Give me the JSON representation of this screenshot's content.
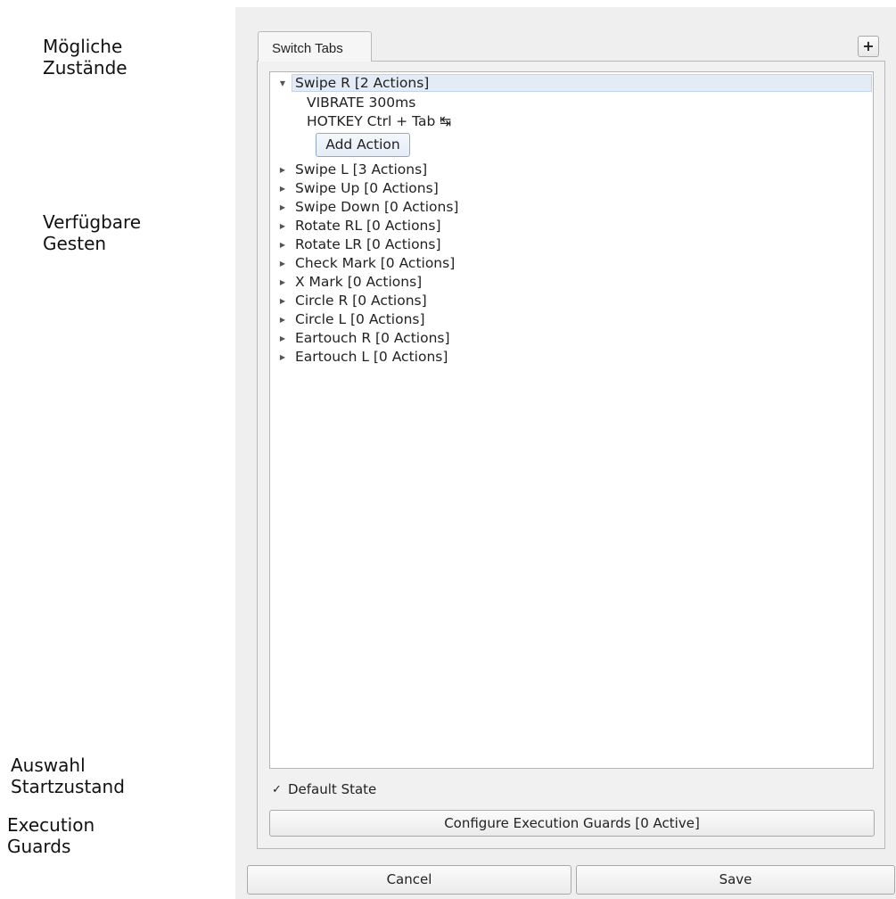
{
  "annotations": {
    "states": "Mögliche\nZustände",
    "gestures": "Verfügbare\nGesten",
    "start_state": "Auswahl\nStartzustand",
    "guards": "Execution\nGuards"
  },
  "tabs": [
    {
      "label": "Switch Tabs",
      "selected": true
    }
  ],
  "add_tab_label": "+",
  "tree": {
    "expanded_item": {
      "label": "Swipe R [2 Actions]",
      "actions": [
        "VIBRATE 300ms",
        "HOTKEY Ctrl + Tab ↹"
      ],
      "add_action_label": "Add Action"
    },
    "items": [
      "Swipe L [3 Actions]",
      "Swipe Up [0 Actions]",
      "Swipe Down [0 Actions]",
      "Rotate RL [0 Actions]",
      "Rotate LR [0 Actions]",
      "Check Mark [0 Actions]",
      "X Mark [0 Actions]",
      "Circle R [0 Actions]",
      "Circle L [0 Actions]",
      "Eartouch R [0 Actions]",
      "Eartouch L [0 Actions]"
    ]
  },
  "default_state": {
    "label": "Default State",
    "checked": true,
    "mark": "✓"
  },
  "guards_button_label": "Configure Execution Guards [0 Active]",
  "footer": {
    "cancel_label": "Cancel",
    "save_label": "Save"
  },
  "icons": {
    "expanded": "triangle-down-icon",
    "collapsed": "triangle-right-icon"
  }
}
